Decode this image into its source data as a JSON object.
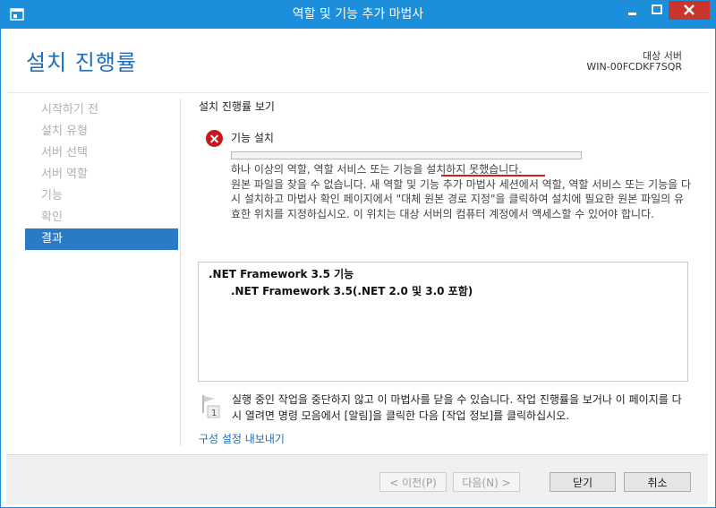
{
  "window": {
    "title": "역할 및 기능 추가 마법사"
  },
  "header": {
    "page_title": "설치 진행률",
    "server_label": "대상 서버",
    "server_name": "WIN-00FCDKF7SQR"
  },
  "nav": {
    "items": [
      {
        "label": "시작하기 전"
      },
      {
        "label": "설치 유형"
      },
      {
        "label": "서버 선택"
      },
      {
        "label": "서버 역할"
      },
      {
        "label": "기능"
      },
      {
        "label": "확인"
      },
      {
        "label": "결과"
      }
    ],
    "active_index": 6
  },
  "content": {
    "section_title": "설치 진행률 보기",
    "status_title": "기능 설치",
    "progress_fraction": 0.0,
    "message_line1": "하나 이상의 역할, 역할 서비스 또는 기능을 설치하지 못했습니다.",
    "message_line2": "원본 파일을 찾을 수 없습니다. 새 역할 및 기능 추가 마법사 세션에서 역할, 역할 서비스 또는 기능을 다시 설치하고 마법사 확인 페이지에서 \"대체 원본 경로 지정\"을 클릭하여 설치에 필요한 원본 파일의 유효한 위치를 지정하십시오. 이 위치는 대상 서버의 컴퓨터 계정에서 액세스할 수 있어야 합니다.",
    "results": [
      ".NET Framework 3.5 기능",
      ".NET Framework 3.5(.NET 2.0 및 3.0 포함)"
    ],
    "info_text": "실행 중인 작업을 중단하지 않고 이 마법사를 닫을 수 있습니다. 작업 진행률을 보거나 이 페이지를 다시 열려면 명령 모음에서 [알림]을 클릭한 다음 [작업 정보]를 클릭하십시오.",
    "export_link": "구성 설정 내보내기"
  },
  "footer": {
    "prev": "< 이전(P)",
    "next": "다음(N) >",
    "close": "닫기",
    "cancel": "취소"
  },
  "colors": {
    "titlebar": "#1c8fdc",
    "accent": "#2b7bc4",
    "error": "#c8161d",
    "close_button": "#c7352b"
  }
}
